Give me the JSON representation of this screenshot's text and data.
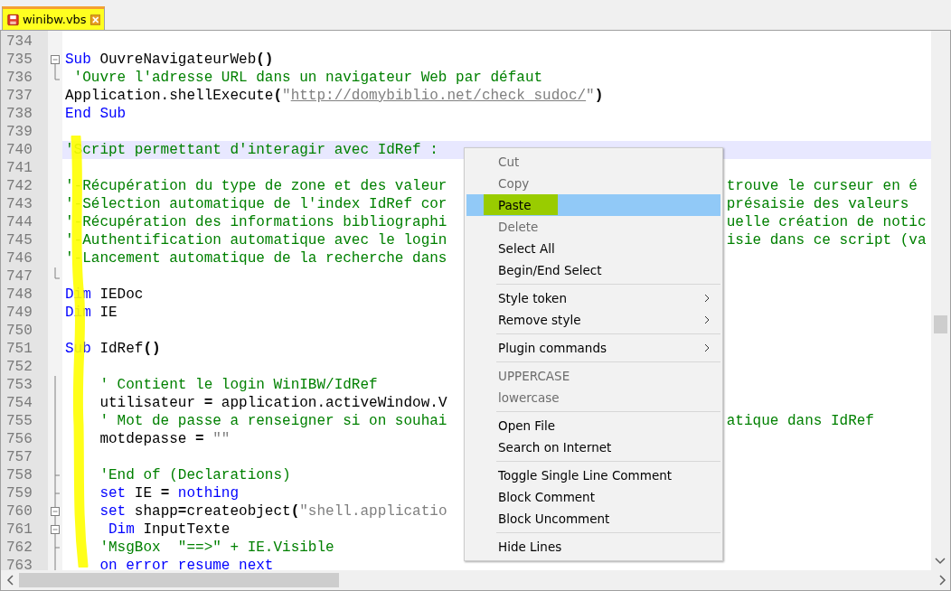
{
  "tab": {
    "title": "winibw.vbs",
    "selected": true
  },
  "lines": [
    {
      "number": "734",
      "kind": "plain",
      "current": false
    },
    {
      "number": "735",
      "kind": "fold-open",
      "current": false,
      "tokens": [
        {
          "t": "Sub",
          "kind": "keyword"
        },
        {
          "t": " OuvreNavigateurWeb",
          "kind": "plain"
        },
        {
          "t": "()",
          "kind": "bold"
        }
      ]
    },
    {
      "number": "736",
      "kind": "fold-end",
      "current": false,
      "tokens": [
        {
          "t": " 'Ouvre l'adresse URL dans un navigateur Web par défaut",
          "kind": "comment"
        }
      ]
    },
    {
      "number": "737",
      "kind": "plain",
      "current": false,
      "tokens": [
        {
          "t": "Application.shellExecute",
          "kind": "plain"
        },
        {
          "t": "(",
          "kind": "bold"
        },
        {
          "t": "\"",
          "kind": "string"
        },
        {
          "t": "http://domybiblio.net/check_sudoc/",
          "kind": "link"
        },
        {
          "t": "\"",
          "kind": "string"
        },
        {
          "t": ")",
          "kind": "bold"
        }
      ]
    },
    {
      "number": "738",
      "kind": "plain",
      "current": false,
      "tokens": [
        {
          "t": "End Sub",
          "kind": "keyword"
        }
      ]
    },
    {
      "number": "739",
      "kind": "plain",
      "current": false
    },
    {
      "number": "740",
      "kind": "plain",
      "current": true,
      "tokens": [
        {
          "t": "'Script permettant d'interagir avec IdRef :",
          "kind": "comment"
        }
      ]
    },
    {
      "number": "741",
      "kind": "plain",
      "current": false
    },
    {
      "number": "742",
      "kind": "plain",
      "current": false,
      "tokens": [
        {
          "t": "'-Récupération du type de zone et des valeur",
          "kind": "comment"
        }
      ],
      "right": "trouve le curseur en é"
    },
    {
      "number": "743",
      "kind": "plain",
      "current": false,
      "tokens": [
        {
          "t": "'-Sélection automatique de l'index IdRef cor",
          "kind": "comment"
        }
      ],
      "right": "présaisie des valeurs"
    },
    {
      "number": "744",
      "kind": "plain",
      "current": false,
      "tokens": [
        {
          "t": "'-Récupération des informations bibliographi",
          "kind": "comment"
        }
      ],
      "right": "uelle création de notic"
    },
    {
      "number": "745",
      "kind": "plain",
      "current": false,
      "tokens": [
        {
          "t": "'-Authentification automatique avec le login",
          "kind": "comment"
        }
      ],
      "right": "isie dans ce script (va"
    },
    {
      "number": "746",
      "kind": "plain",
      "current": false,
      "tokens": [
        {
          "t": "'-Lancement automatique de la recherche dans",
          "kind": "comment"
        }
      ]
    },
    {
      "number": "747",
      "kind": "fold-end",
      "current": false
    },
    {
      "number": "748",
      "kind": "plain",
      "current": false,
      "tokens": [
        {
          "t": "Dim",
          "kind": "keyword"
        },
        {
          "t": " IEDoc",
          "kind": "plain"
        }
      ]
    },
    {
      "number": "749",
      "kind": "plain",
      "current": false,
      "tokens": [
        {
          "t": "Dim",
          "kind": "keyword"
        },
        {
          "t": " IE",
          "kind": "plain"
        }
      ]
    },
    {
      "number": "750",
      "kind": "plain",
      "current": false
    },
    {
      "number": "751",
      "kind": "plain",
      "current": false,
      "tokens": [
        {
          "t": "Sub",
          "kind": "keyword"
        },
        {
          "t": " IdRef",
          "kind": "plain"
        },
        {
          "t": "()",
          "kind": "bold"
        }
      ]
    },
    {
      "number": "752",
      "kind": "plain",
      "current": false
    },
    {
      "number": "753",
      "kind": "fold-line",
      "current": false,
      "tokens": [
        {
          "t": "    ' Contient le login WinIBW/IdRef",
          "kind": "comment"
        }
      ]
    },
    {
      "number": "754",
      "kind": "fold-line",
      "current": false,
      "tokens": [
        {
          "t": "    utilisateur ",
          "kind": "plain"
        },
        {
          "t": "=",
          "kind": "bold"
        },
        {
          "t": " application.activeWindow.V",
          "kind": "plain"
        }
      ]
    },
    {
      "number": "755",
      "kind": "fold-line",
      "current": false,
      "tokens": [
        {
          "t": "    ' Mot de passe a renseigner si on souhai",
          "kind": "comment"
        }
      ],
      "right": "atique dans IdRef"
    },
    {
      "number": "756",
      "kind": "fold-line",
      "current": false,
      "tokens": [
        {
          "t": "    motdepasse ",
          "kind": "plain"
        },
        {
          "t": "=",
          "kind": "bold"
        },
        {
          "t": " \"\"",
          "kind": "string"
        }
      ]
    },
    {
      "number": "757",
      "kind": "fold-line",
      "current": false
    },
    {
      "number": "758",
      "kind": "fold-branch",
      "current": false,
      "tokens": [
        {
          "t": "    'End of (Declarations)",
          "kind": "comment"
        }
      ]
    },
    {
      "number": "759",
      "kind": "fold-branch",
      "current": false,
      "tokens": [
        {
          "t": "    set",
          "kind": "keyword"
        },
        {
          "t": " IE ",
          "kind": "plain"
        },
        {
          "t": "=",
          "kind": "bold"
        },
        {
          "t": " nothing",
          "kind": "keyword"
        }
      ]
    },
    {
      "number": "760",
      "kind": "fold-nested",
      "current": false,
      "tokens": [
        {
          "t": "    set",
          "kind": "keyword"
        },
        {
          "t": " shapp",
          "kind": "plain"
        },
        {
          "t": "=",
          "kind": "bold"
        },
        {
          "t": "createobject",
          "kind": "plain"
        },
        {
          "t": "(",
          "kind": "bold"
        },
        {
          "t": "\"shell.applicatio",
          "kind": "string"
        }
      ]
    },
    {
      "number": "761",
      "kind": "fold-nested",
      "current": false,
      "tokens": [
        {
          "t": "     Dim",
          "kind": "keyword"
        },
        {
          "t": " InputTexte",
          "kind": "plain"
        }
      ]
    },
    {
      "number": "762",
      "kind": "fold-branch",
      "current": false,
      "tokens": [
        {
          "t": "    'MsgBox  \"==>\" + IE.Visible",
          "kind": "comment"
        }
      ]
    },
    {
      "number": "763",
      "kind": "fold-line",
      "current": false,
      "tokens": [
        {
          "t": "    on error resume next",
          "kind": "keyword"
        }
      ]
    }
  ],
  "context_menu": [
    {
      "kind": "item",
      "label": "Cut",
      "disabled": true,
      "selected": false,
      "submenu": false
    },
    {
      "kind": "item",
      "label": "Copy",
      "disabled": true,
      "selected": false,
      "submenu": false
    },
    {
      "kind": "item",
      "label": "Paste",
      "disabled": false,
      "selected": true,
      "submenu": false
    },
    {
      "kind": "item",
      "label": "Delete",
      "disabled": true,
      "selected": false,
      "submenu": false
    },
    {
      "kind": "item",
      "label": "Select All",
      "disabled": false,
      "selected": false,
      "submenu": false
    },
    {
      "kind": "item",
      "label": "Begin/End Select",
      "disabled": false,
      "selected": false,
      "submenu": false
    },
    {
      "kind": "separator"
    },
    {
      "kind": "item",
      "label": "Style token",
      "disabled": false,
      "selected": false,
      "submenu": true
    },
    {
      "kind": "item",
      "label": "Remove style",
      "disabled": false,
      "selected": false,
      "submenu": true
    },
    {
      "kind": "separator"
    },
    {
      "kind": "item",
      "label": "Plugin commands",
      "disabled": false,
      "selected": false,
      "submenu": true
    },
    {
      "kind": "separator"
    },
    {
      "kind": "item",
      "label": "UPPERCASE",
      "disabled": true,
      "selected": false,
      "submenu": false
    },
    {
      "kind": "item",
      "label": "lowercase",
      "disabled": true,
      "selected": false,
      "submenu": false
    },
    {
      "kind": "separator"
    },
    {
      "kind": "item",
      "label": "Open File",
      "disabled": false,
      "selected": false,
      "submenu": false
    },
    {
      "kind": "item",
      "label": "Search on Internet",
      "disabled": false,
      "selected": false,
      "submenu": false
    },
    {
      "kind": "separator"
    },
    {
      "kind": "item",
      "label": "Toggle Single Line Comment",
      "disabled": false,
      "selected": false,
      "submenu": false
    },
    {
      "kind": "item",
      "label": "Block Comment",
      "disabled": false,
      "selected": false,
      "submenu": false
    },
    {
      "kind": "item",
      "label": "Block Uncomment",
      "disabled": false,
      "selected": false,
      "submenu": false
    },
    {
      "kind": "separator"
    },
    {
      "kind": "item",
      "label": "Hide Lines",
      "disabled": false,
      "selected": false,
      "submenu": false
    }
  ]
}
